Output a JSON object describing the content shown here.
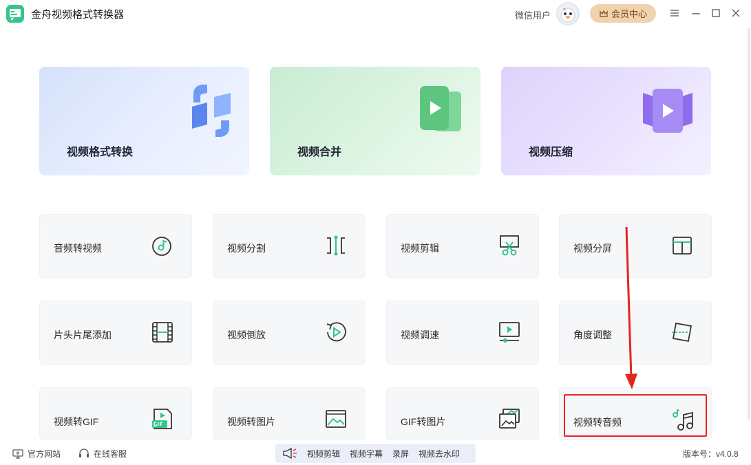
{
  "app": {
    "title": "金舟视频格式转换器",
    "user_name": "微信用户",
    "vip_label": "会员中心"
  },
  "colors": {
    "accent": "#36c58a",
    "highlight": "#e52421",
    "vip": "#f1d2ac"
  },
  "feature_cards": [
    {
      "label": "视频格式转换",
      "icon": "format-convert-icon"
    },
    {
      "label": "视频合并",
      "icon": "merge-video-icon"
    },
    {
      "label": "视频压缩",
      "icon": "compress-video-icon"
    }
  ],
  "tools": [
    {
      "label": "音频转视频",
      "icon": "audio-to-video-icon"
    },
    {
      "label": "视频分割",
      "icon": "split-icon"
    },
    {
      "label": "视频剪辑",
      "icon": "scissors-icon"
    },
    {
      "label": "视频分屏",
      "icon": "split-screen-icon"
    },
    {
      "label": "片头片尾添加",
      "icon": "film-strip-icon"
    },
    {
      "label": "视频倒放",
      "icon": "rewind-icon"
    },
    {
      "label": "视频调速",
      "icon": "speed-icon"
    },
    {
      "label": "角度调整",
      "icon": "rotate-icon"
    },
    {
      "label": "视频转GIF",
      "icon": "gif-icon"
    },
    {
      "label": "视频转图片",
      "icon": "image-icon"
    },
    {
      "label": "GIF转图片",
      "icon": "gif-to-image-icon"
    },
    {
      "label": "视频转音频",
      "icon": "music-note-icon"
    }
  ],
  "footer": {
    "website": "官方网站",
    "support": "在线客服",
    "quick_tools": [
      "视频剪辑",
      "视频字幕",
      "录屏",
      "视频去水印"
    ],
    "version": "版本号：v4.0.8"
  }
}
